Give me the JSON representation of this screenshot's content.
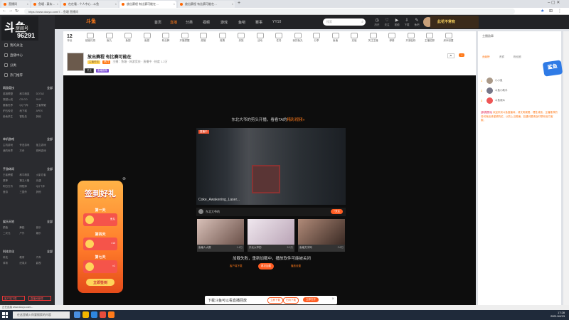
{
  "browser": {
    "tabs": [
      {
        "label": "直播间"
      },
      {
        "label": "鱼塘 - 真实…"
      },
      {
        "label": "在在看 - 个人中心 - 斗鱼"
      },
      {
        "label": "放出赛程 有比赛可能在…"
      },
      {
        "label": "放出赛程 有比赛可能在…"
      }
    ],
    "url": "https://www.douyu.com/7... 鱼塘 直播间"
  },
  "sidebar": {
    "logo_big": "斗鱼",
    "logo_sub": "房间号",
    "room_number": "96291",
    "nav": [
      "我的关注",
      "直播中心",
      "分类",
      "热门推荐"
    ],
    "sections": [
      {
        "title": "网游竞技",
        "more": "全部",
        "items": [
          "英雄联盟",
          "和平精英",
          "DOTA2",
          "穿越火线",
          "CS:GO",
          "DNF",
          "魔兽世界",
          "QQ飞车",
          "王者荣耀",
          "炉石传说",
          "地下城",
          "APEX",
          "绝地求生",
          "冒险岛",
          "其他"
        ]
      },
      {
        "title": "单机游戏",
        "more": "全部",
        "items": [
          "主机游戏",
          "怀旧游戏",
          "独立游戏",
          "我的世界",
          "方舟",
          "恐怖游戏"
        ]
      },
      {
        "title": "手游休闲",
        "more": "全部",
        "items": [
          "王者荣耀",
          "和平精英",
          "火影忍者",
          "原神",
          "第五人格",
          "光遇",
          "明日方舟",
          "阴阳师",
          "QQ飞车",
          "音游",
          "三国杀",
          "其他"
        ]
      },
      {
        "title": "娱乐天地",
        "more": "全部",
        "items": [
          "颜值",
          "舞蹈",
          "音乐",
          "二次元",
          "户外",
          "娱乐"
        ]
      },
      {
        "title": "科技文化",
        "more": "全部",
        "items": [
          "科技",
          "教育",
          "汽车",
          "体育",
          "纪录片",
          "影视"
        ]
      }
    ],
    "bottom_buttons": [
      "客户端下载",
      "直播间管理"
    ]
  },
  "topnav": {
    "logo": "斗鱼",
    "items": [
      "首页",
      "直播",
      "分类",
      "视频",
      "游戏",
      "鱼吧",
      "赛事",
      "YY10"
    ],
    "active": "直播",
    "search_placeholder": "搜索",
    "icons": [
      {
        "name": "history-icon",
        "label": "历史"
      },
      {
        "name": "follow-icon",
        "label": "关注"
      },
      {
        "name": "video-icon",
        "label": "视频"
      },
      {
        "name": "download-icon",
        "label": "下载"
      },
      {
        "name": "creator-icon",
        "label": "鱼吧"
      },
      {
        "name": "message-icon",
        "label": "消息"
      },
      {
        "name": "task-icon",
        "label": "任务"
      }
    ],
    "banner_text": "此花不常有"
  },
  "room": {
    "level_num": "12",
    "level_label": "等级",
    "gift_icons": [
      "超级礼物",
      "鱼丸",
      "鱼翅",
      "鱼翅",
      "粉丝牌",
      "开播提醒",
      "超管",
      "竞猜",
      "贵族",
      "活动",
      "任务",
      "我的鱼丸",
      "分享",
      "鱼塘",
      "充值",
      "关注主播",
      "弹幕",
      "开通钻粉",
      "主播招募",
      "房间设置"
    ],
    "title": "放出赛程 有比赛可能在",
    "meta": "主播：鱼塘  ·  网游竞技  ·  直播中  ·  热度 1.2万",
    "badges": [
      "主播任务",
      "热门"
    ],
    "tags": [
      "关注",
      "鱼塘推荐"
    ]
  },
  "player": {
    "headline_prefix": "东北大爷的剪头开播，看看TA的",
    "headline_link": "精彩视频»",
    "video_title": "Coke_Awakening_Laser...",
    "live_label": "直播中",
    "streamer": "东北大爷的",
    "follow_label": "+关注",
    "thumbnails": [
      {
        "caption": "鱼塘人大赛",
        "count": "1.4万"
      },
      {
        "caption": "东北大爷的",
        "count": "5.3万"
      },
      {
        "caption": "鱼塘文字网",
        "count": "2.6万"
      }
    ],
    "promo_line": "加载失败，重新加载中，播放软件可能被关闭",
    "promo_buttons": [
      "客户端下载",
      "再次加载",
      "播放设置"
    ]
  },
  "signcard": {
    "title": "签到好礼",
    "days": [
      {
        "label": "第一天",
        "tag": "鱼丸"
      },
      {
        "label": "第四天",
        "tag": "×10"
      },
      {
        "label": "第七天",
        "tag": "×1"
      }
    ],
    "go_label": "立即签到"
  },
  "download_bar": {
    "text": "下载斗鱼可以看直播回放",
    "btn1": "立即下载",
    "btn2": "扫码下载",
    "btn3": "立即打开"
  },
  "right_panel": {
    "top_text": "主播勋章",
    "tabs": [
      "贡献榜",
      "贵宾",
      "粉丝团"
    ],
    "users": [
      {
        "rank": "1",
        "name": "小小鱼"
      },
      {
        "rank": "2",
        "name": "斗鱼小助手"
      },
      {
        "rank": "3",
        "name": "斗鱼观众"
      }
    ],
    "floatlogo": "鲨鱼",
    "notice_key": "[系统提示]",
    "notice": "欢迎来到斗鱼直播间，请文明观看，理性消费，主播推荐的任何商品请谨慎购买，以防上当受骗，如遇问题请及时联系官方客服。"
  },
  "statusbar": "正在连接 www.douyu.com...",
  "taskbar": {
    "search_placeholder": "在这里输入你要搜索的内容",
    "time": "17:28",
    "date": "2021/10/13"
  }
}
